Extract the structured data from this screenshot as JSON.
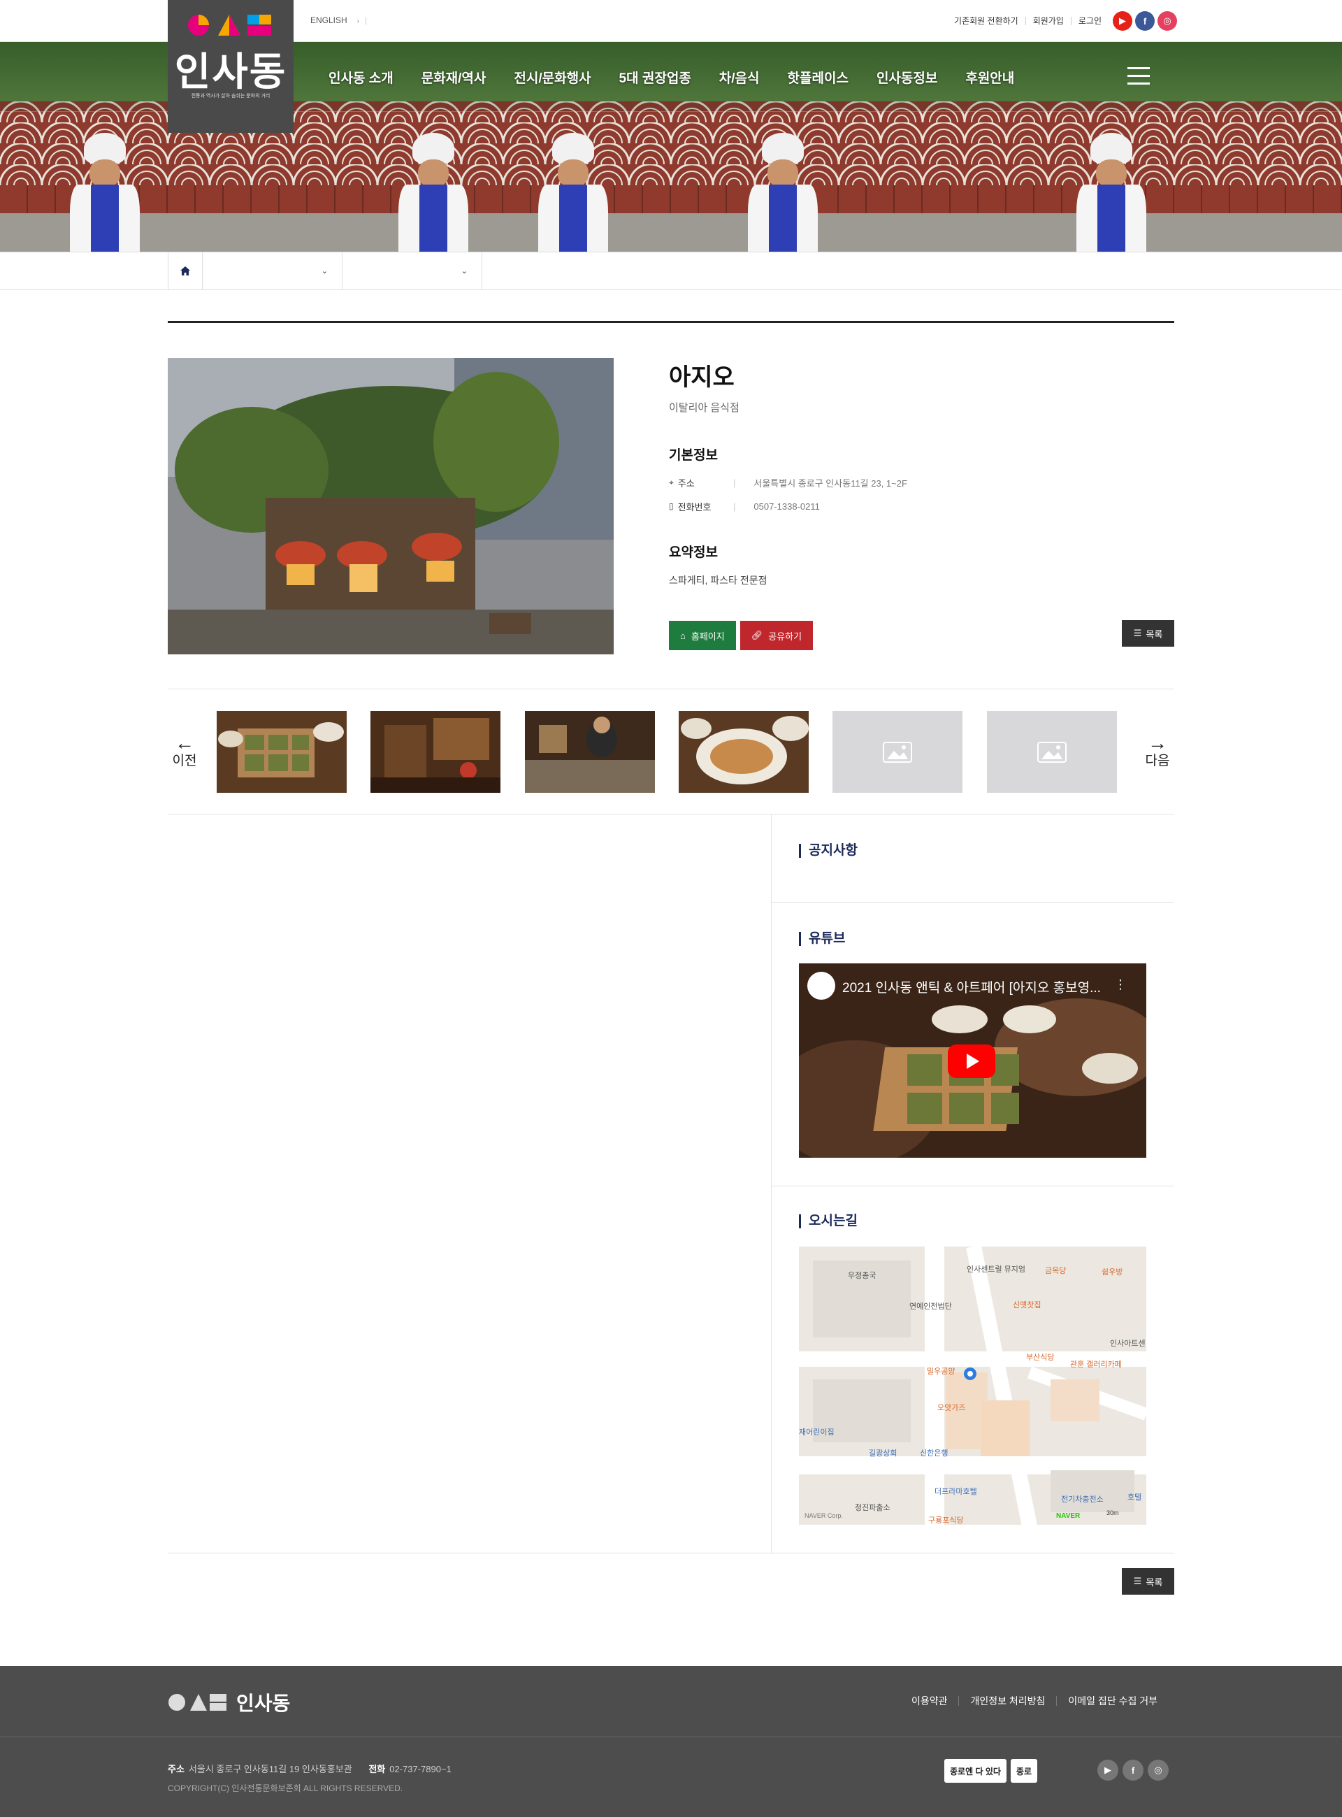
{
  "header": {
    "logo_text": "인사동",
    "logo_sub": "전통과 역사가 살아 숨쉬는 문화의 거리",
    "lang_label": "ENGLISH",
    "util_links": [
      "기존회원 전환하기",
      "회원가입",
      "로그인"
    ],
    "nav": [
      "인사동 소개",
      "문화재/역사",
      "전시/문화행사",
      "5대 권장업종",
      "차/음식",
      "핫플레이스",
      "인사동정보",
      "후원안내"
    ],
    "brand_colors": {
      "youtube": "#e62117",
      "facebook": "#3b5998",
      "instagram": "#e4405f"
    }
  },
  "breadcrumb": {
    "home_icon": "home-icon",
    "select1": "",
    "select2": ""
  },
  "place": {
    "name": "아지오",
    "category": "이탈리아 음식점",
    "basic_info_title": "기본정보",
    "address_label": "주소",
    "address": "서울특별시 종로구 인사동11길 23, 1~2F",
    "phone_label": "전화번호",
    "phone": "0507-1338-0211",
    "summary_title": "요약정보",
    "summary": "스파게티, 파스타 전문점",
    "homepage_button": "홈페이지",
    "share_button": "공유하기",
    "list_button": "목록"
  },
  "gallery": {
    "prev_label": "이전",
    "next_label": "다음",
    "thumbs": [
      "food-tray",
      "restaurant-interior",
      "kitchen-chef",
      "pasta-plates",
      "placeholder",
      "placeholder"
    ]
  },
  "sidebar": {
    "notice_title": "공지사항",
    "youtube_title": "유튜브",
    "video_title": "2021 인사동 앤틱 & 아트페어 [아지오 홍보영...",
    "map_title": "오시는길",
    "map_labels": [
      "우정총국",
      "인사센트럴 뮤지엄",
      "금옥당",
      "쉼우방",
      "연예인전법단",
      "신옛찻집",
      "인사아트센",
      "부산식당",
      "밀우공양",
      "관훈 갤러리카페",
      "오앗가즈",
      "재어린이집",
      "길광상회",
      "신한은행",
      "더프라마호텔",
      "청진파출소",
      "구룡포식당",
      "전기차충전소",
      "호텔",
      "NAVER Corp.",
      "30m",
      "NAVER"
    ]
  },
  "bottom": {
    "list_button": "목록"
  },
  "footer": {
    "logo_text": "인사동",
    "links": [
      "이용약관",
      "개인정보 처리방침",
      "이메일 집단 수집 거부"
    ],
    "address_label": "주소",
    "address": "서울시 종로구 인사동11길 19 인사동홍보관",
    "phone_label": "전화",
    "phone": "02-737-7890~1",
    "copyright": "COPYRIGHT(C) 인사전통문화보존회 ALL RIGHTS RESERVED.",
    "badge1": "종로엔 다 있다",
    "badge2": "종로"
  }
}
